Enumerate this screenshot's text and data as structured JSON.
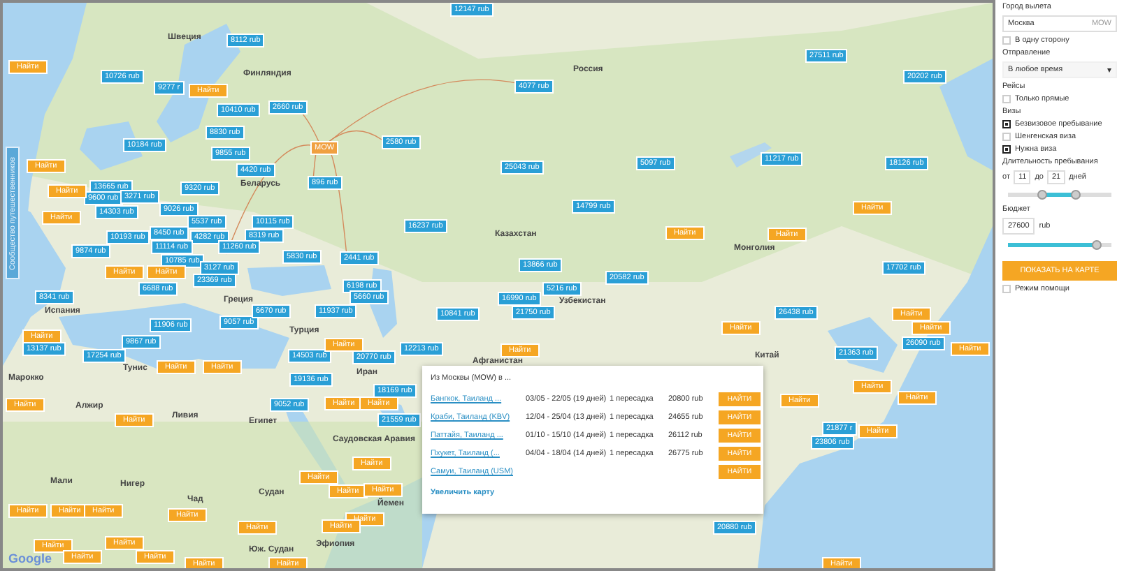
{
  "side_tab": {
    "label": "Сообщество путешественников"
  },
  "map_labels": [
    "Швеция",
    "Финляндия",
    "Беларусь",
    "Россия",
    "Казахстан",
    "Монголия",
    "Китай",
    "Узбекистан",
    "Афганистан",
    "Турция",
    "Иран",
    "Саудовская Аравия",
    "Египет",
    "Ливия",
    "Алжир",
    "Марокко",
    "Мали",
    "Нигер",
    "Чад",
    "Судан",
    "Юж. Судан",
    "Эфиопия",
    "Йемен",
    "Испания",
    "Греция",
    "Тунис"
  ],
  "pins": [
    {
      "label": "MOW",
      "kind": "origin"
    },
    {
      "label": "12147 rub",
      "kind": "price"
    },
    {
      "label": "8112 rub",
      "kind": "price"
    },
    {
      "label": "10726 rub",
      "kind": "price"
    },
    {
      "label": "9277 r",
      "kind": "price"
    },
    {
      "label": "10410 rub",
      "kind": "price"
    },
    {
      "label": "2660 rub",
      "kind": "price"
    },
    {
      "label": "8830 rub",
      "kind": "price"
    },
    {
      "label": "10184 rub",
      "kind": "price"
    },
    {
      "label": "9855 rub",
      "kind": "price"
    },
    {
      "label": "4420 rub",
      "kind": "price"
    },
    {
      "label": "9320 rub",
      "kind": "price"
    },
    {
      "label": "896 rub",
      "kind": "price"
    },
    {
      "label": "2580 rub",
      "kind": "price"
    },
    {
      "label": "13665 rub",
      "kind": "price"
    },
    {
      "label": "9600 rub",
      "kind": "price"
    },
    {
      "label": "3271 rub",
      "kind": "price"
    },
    {
      "label": "14303 rub",
      "kind": "price"
    },
    {
      "label": "9026 rub",
      "kind": "price"
    },
    {
      "label": "5537 rub",
      "kind": "price"
    },
    {
      "label": "10115 rub",
      "kind": "price"
    },
    {
      "label": "10193 rub",
      "kind": "price"
    },
    {
      "label": "8450 rub",
      "kind": "price"
    },
    {
      "label": "4282 rub",
      "kind": "price"
    },
    {
      "label": "8319 rub",
      "kind": "price"
    },
    {
      "label": "11114 rub",
      "kind": "price"
    },
    {
      "label": "11260 rub",
      "kind": "price"
    },
    {
      "label": "9874 rub",
      "kind": "price"
    },
    {
      "label": "5830 rub",
      "kind": "price"
    },
    {
      "label": "2441 rub",
      "kind": "price"
    },
    {
      "label": "10785 rub",
      "kind": "price"
    },
    {
      "label": "3127 rub",
      "kind": "price"
    },
    {
      "label": "23369 rub",
      "kind": "price"
    },
    {
      "label": "16237 rub",
      "kind": "price"
    },
    {
      "label": "6198 rub",
      "kind": "price"
    },
    {
      "label": "8341 rub",
      "kind": "price"
    },
    {
      "label": "5660 rub",
      "kind": "price"
    },
    {
      "label": "6688 rub",
      "kind": "price"
    },
    {
      "label": "4077 rub",
      "kind": "price"
    },
    {
      "label": "27511 rub",
      "kind": "price"
    },
    {
      "label": "20202 rub",
      "kind": "price"
    },
    {
      "label": "25043 rub",
      "kind": "price"
    },
    {
      "label": "5097 rub",
      "kind": "price"
    },
    {
      "label": "11217 rub",
      "kind": "price"
    },
    {
      "label": "18126 rub",
      "kind": "price"
    },
    {
      "label": "14799 rub",
      "kind": "price"
    },
    {
      "label": "13866 rub",
      "kind": "price"
    },
    {
      "label": "20582 rub",
      "kind": "price"
    },
    {
      "label": "5216 rub",
      "kind": "price"
    },
    {
      "label": "16990 rub",
      "kind": "price"
    },
    {
      "label": "21750 rub",
      "kind": "price"
    },
    {
      "label": "26438 rub",
      "kind": "price"
    },
    {
      "label": "17702 rub",
      "kind": "price"
    },
    {
      "label": "26090 rub",
      "kind": "price"
    },
    {
      "label": "21363 rub",
      "kind": "price"
    },
    {
      "label": "13137 rub",
      "kind": "price"
    },
    {
      "label": "17254 rub",
      "kind": "price"
    },
    {
      "label": "9867 rub",
      "kind": "price"
    },
    {
      "label": "11906 rub",
      "kind": "price"
    },
    {
      "label": "9057 rub",
      "kind": "price"
    },
    {
      "label": "6670 rub",
      "kind": "price"
    },
    {
      "label": "11937 rub",
      "kind": "price"
    },
    {
      "label": "14503 rub",
      "kind": "price"
    },
    {
      "label": "20770 rub",
      "kind": "price"
    },
    {
      "label": "12213 rub",
      "kind": "price"
    },
    {
      "label": "19136 rub",
      "kind": "price"
    },
    {
      "label": "18169 rub",
      "kind": "price"
    },
    {
      "label": "9052 rub",
      "kind": "price"
    },
    {
      "label": "21559 rub",
      "kind": "price"
    },
    {
      "label": "10841 rub",
      "kind": "price"
    },
    {
      "label": "21877 r",
      "kind": "price"
    },
    {
      "label": "23806 rub",
      "kind": "price"
    },
    {
      "label": "20880 rub",
      "kind": "price"
    },
    {
      "label": "Найти",
      "kind": "search"
    },
    {
      "label": "Найти",
      "kind": "search"
    },
    {
      "label": "Найти",
      "kind": "search"
    },
    {
      "label": "Найти",
      "kind": "search"
    },
    {
      "label": "Найти",
      "kind": "search"
    },
    {
      "label": "Найти",
      "kind": "search"
    },
    {
      "label": "Найти",
      "kind": "search"
    },
    {
      "label": "Найти",
      "kind": "search"
    },
    {
      "label": "Найти",
      "kind": "search"
    },
    {
      "label": "Найти",
      "kind": "search"
    },
    {
      "label": "Найти",
      "kind": "search"
    },
    {
      "label": "Найти",
      "kind": "search"
    },
    {
      "label": "Найти",
      "kind": "search"
    },
    {
      "label": "Найти",
      "kind": "search"
    },
    {
      "label": "Найти",
      "kind": "search"
    },
    {
      "label": "Найти",
      "kind": "search"
    },
    {
      "label": "Найти",
      "kind": "search"
    },
    {
      "label": "Найти",
      "kind": "search"
    },
    {
      "label": "Найти",
      "kind": "search"
    },
    {
      "label": "Найти",
      "kind": "search"
    },
    {
      "label": "Найти",
      "kind": "search"
    },
    {
      "label": "Найти",
      "kind": "search"
    },
    {
      "label": "Найти",
      "kind": "search"
    },
    {
      "label": "Найти",
      "kind": "search"
    },
    {
      "label": "Найти",
      "kind": "search"
    },
    {
      "label": "Найти",
      "kind": "search"
    },
    {
      "label": "Найти",
      "kind": "search"
    },
    {
      "label": "Найти",
      "kind": "search"
    },
    {
      "label": "Найти",
      "kind": "search"
    },
    {
      "label": "Найти",
      "kind": "search"
    },
    {
      "label": "Найти",
      "kind": "search"
    },
    {
      "label": "Найти",
      "kind": "search"
    },
    {
      "label": "Найти",
      "kind": "search"
    },
    {
      "label": "Найти",
      "kind": "search"
    },
    {
      "label": "Найти",
      "kind": "search"
    },
    {
      "label": "Найти",
      "kind": "search"
    },
    {
      "label": "Найти",
      "kind": "search"
    },
    {
      "label": "Найти",
      "kind": "search"
    },
    {
      "label": "Найти",
      "kind": "search"
    },
    {
      "label": "Найти",
      "kind": "search"
    },
    {
      "label": "Найти",
      "kind": "search"
    },
    {
      "label": "Найти",
      "kind": "search"
    },
    {
      "label": "Найти",
      "kind": "search"
    },
    {
      "label": "Найти",
      "kind": "search"
    },
    {
      "label": "Найти",
      "kind": "search"
    }
  ],
  "popup": {
    "title": "Из Москвы (MOW) в ...",
    "rows": [
      {
        "destination": "Бангкок, Таиланд ...",
        "dates": "03/05 - 22/05 (19 дней)",
        "transfers": "1 пересадка",
        "price": "20800 rub",
        "button": "НАЙТИ"
      },
      {
        "destination": "Краби, Таиланд (KBV)",
        "dates": "12/04 - 25/04 (13 дней)",
        "transfers": "1 пересадка",
        "price": "24655 rub",
        "button": "НАЙТИ"
      },
      {
        "destination": "Паттайя, Таиланд ...",
        "dates": "01/10 - 15/10 (14 дней)",
        "transfers": "1 пересадка",
        "price": "26112 rub",
        "button": "НАЙТИ"
      },
      {
        "destination": "Пхукет, Таиланд (...",
        "dates": "04/04 - 18/04 (14 дней)",
        "transfers": "1 пересадка",
        "price": "26775 rub",
        "button": "НАЙТИ"
      },
      {
        "destination": "Самуи, Таиланд (USM)",
        "button": "НАЙТИ"
      }
    ],
    "footer_link": "Увеличить карту"
  },
  "google_logo": "Google",
  "sidebar": {
    "city_label": "Город вылета",
    "city_value": "Москва",
    "city_code": "MOW",
    "one_way": {
      "label": "В одну сторону",
      "checked": false
    },
    "departure_label": "Отправление",
    "departure_value": "В любое время",
    "departure_caret": "▾",
    "flights_label": "Рейсы",
    "direct_only": {
      "label": "Только прямые",
      "checked": false
    },
    "visas_label": "Визы",
    "visas": [
      {
        "label": "Безвизовое пребывание",
        "checked": true
      },
      {
        "label": "Шенгенская виза",
        "checked": false
      },
      {
        "label": "Нужна виза",
        "checked": true
      }
    ],
    "duration_label": "Длительность пребывания",
    "from_label": "от",
    "from_value": "11",
    "to_label": "до",
    "to_value": "21",
    "days_label": "дней",
    "duration_slider": [
      {
        "level": 0.33
      },
      {
        "level": 0.66
      }
    ],
    "budget_label": "Бюджет",
    "budget_value": "27600",
    "budget_unit": "rub",
    "budget_slider": {
      "level": 0.86
    },
    "show_button": "ПОКАЗАТЬ НА КАРТЕ",
    "help_mode": {
      "label": "Режим помощи",
      "checked": false
    }
  }
}
